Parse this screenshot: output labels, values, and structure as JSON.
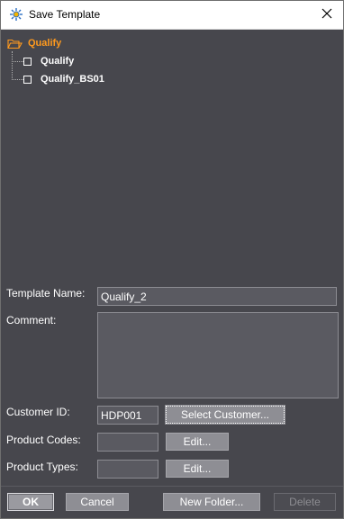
{
  "window": {
    "title": "Save Template",
    "title_icon": "gear-sparkle-icon",
    "close_icon": "close-icon"
  },
  "tree": {
    "root": {
      "label": "Qualify",
      "icon": "folder-open-icon",
      "color": "#ff9a1e"
    },
    "children": [
      {
        "label": "Qualify",
        "icon": "checkbox-icon"
      },
      {
        "label": "Qualify_BS01",
        "icon": "checkbox-icon"
      }
    ]
  },
  "form": {
    "template_name_label": "Template Name:",
    "template_name_value": "Qualify_2",
    "comment_label": "Comment:",
    "comment_value": "",
    "customer_id_label": "Customer ID:",
    "customer_id_value": "HDP001",
    "select_customer_label": "Select Customer...",
    "product_codes_label": "Product Codes:",
    "product_codes_value": "",
    "product_codes_edit_label": "Edit...",
    "product_types_label": "Product Types:",
    "product_types_value": "",
    "product_types_edit_label": "Edit..."
  },
  "buttons": {
    "ok_label": "OK",
    "cancel_label": "Cancel",
    "new_folder_label": "New Folder...",
    "delete_label": "Delete"
  },
  "colors": {
    "background": "#47474d",
    "accent": "#ff9a1e",
    "button": "#8e8e94"
  }
}
